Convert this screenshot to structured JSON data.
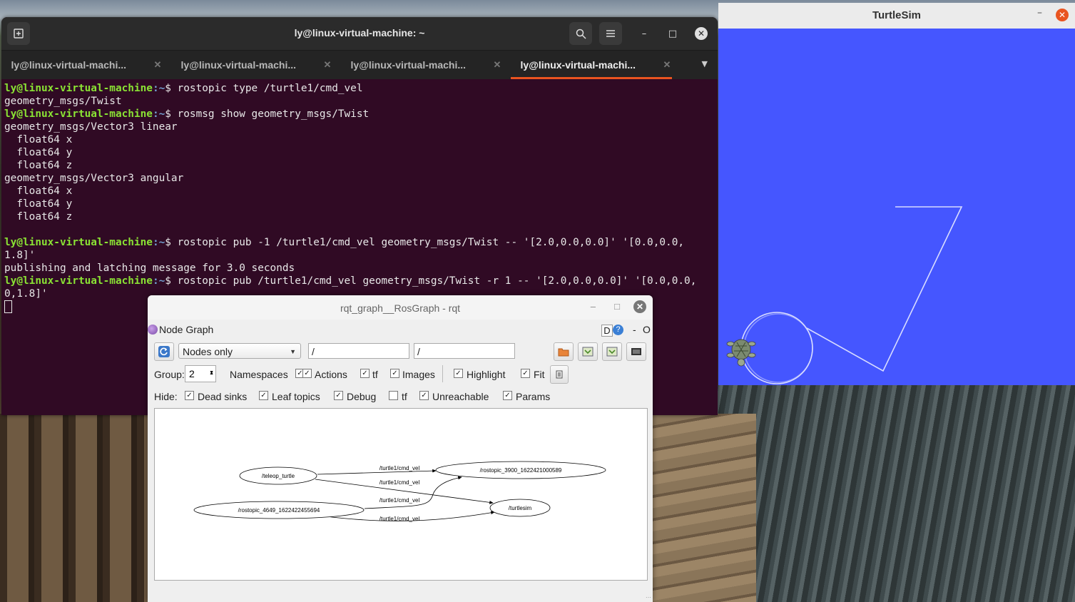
{
  "terminal": {
    "title": "ly@linux-virtual-machine: ~",
    "tabs": [
      {
        "label": "ly@linux-virtual-machi..."
      },
      {
        "label": "ly@linux-virtual-machi..."
      },
      {
        "label": "ly@linux-virtual-machi..."
      },
      {
        "label": "ly@linux-virtual-machi..."
      }
    ],
    "prompt_user": "ly@linux-virtual-machine",
    "prompt_path": ":~",
    "lines": [
      {
        "cmd": "$ rostopic type /turtle1/cmd_vel"
      },
      {
        "out": "geometry_msgs/Twist"
      },
      {
        "cmd": "$ rosmsg show geometry_msgs/Twist"
      },
      {
        "out": "geometry_msgs/Vector3 linear"
      },
      {
        "out": "  float64 x"
      },
      {
        "out": "  float64 y"
      },
      {
        "out": "  float64 z"
      },
      {
        "out": "geometry_msgs/Vector3 angular"
      },
      {
        "out": "  float64 x"
      },
      {
        "out": "  float64 y"
      },
      {
        "out": "  float64 z"
      },
      {
        "out": ""
      },
      {
        "cmd": "$ rostopic pub -1 /turtle1/cmd_vel geometry_msgs/Twist -- '[2.0,0.0,0.0]' '[0.0,0.0,"
      },
      {
        "out": "1.8]'"
      },
      {
        "out": "publishing and latching message for 3.0 seconds"
      },
      {
        "cmd": "$ rostopic pub /turtle1/cmd_vel geometry_msgs/Twist -r 1 -- '[2.0,0.0,0.0]' '[0.0,0.0,"
      },
      {
        "out": "0,1.8]'"
      }
    ]
  },
  "turtlesim": {
    "title": "TurtleSim",
    "background": "#4556ff"
  },
  "rqt": {
    "title": "rqt_graph__RosGraph - rqt",
    "plugin_title": "Node Graph",
    "d_label": "D",
    "help_label": "?",
    "dash_label": "-",
    "o_label": "O",
    "mode_selected": "Nodes only",
    "filter1": "/",
    "filter2": "/",
    "group_label": "Group:",
    "group_value": "2",
    "opts": {
      "namespaces": "Namespaces",
      "actions": "Actions",
      "tf": "tf",
      "images": "Images",
      "highlight": "Highlight",
      "fit": "Fit"
    },
    "hide_label": "Hide:",
    "hide": {
      "dead_sinks": "Dead sinks",
      "leaf_topics": "Leaf topics",
      "debug": "Debug",
      "tf": "tf",
      "unreachable": "Unreachable",
      "params": "Params"
    },
    "graph": {
      "nodes": [
        "/teleop_turtle",
        "/rostopic_3900_1622421000589",
        "/rostopic_4649_1622422455694",
        "/turtlesim"
      ],
      "edge_label": "/turtle1/cmd_vel"
    }
  }
}
